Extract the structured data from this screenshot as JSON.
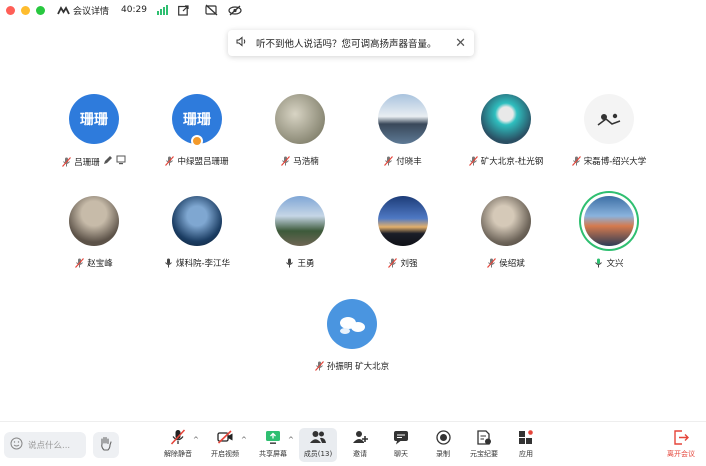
{
  "titlebar": {
    "app_label": "会议详情",
    "timer": "40:29",
    "traffic_colors": [
      "#ff5f57",
      "#febc2e",
      "#28c840"
    ]
  },
  "notice": {
    "text": "听不到他人说话吗？您可调高扬声器音量。"
  },
  "participants": [
    {
      "name": "吕珊珊",
      "avatar_text": "珊珊",
      "status": "muted",
      "extra_icons": true
    },
    {
      "name": "中绿盟吕珊珊",
      "avatar_text": "珊珊",
      "status": "muted",
      "host_badge": true
    },
    {
      "name": "马浩楠",
      "status": "muted",
      "avatar_color": "#6b6a55"
    },
    {
      "name": "付晓丰",
      "status": "muted",
      "avatar_color": "#5e7a96"
    },
    {
      "name": "矿大北京-杜光钢",
      "status": "muted",
      "avatar_color": "#2a4f63"
    },
    {
      "name": "宋磊博-绍兴大学",
      "status": "muted",
      "avatar_color": "#f4f4f4"
    },
    {
      "name": "赵宝峰",
      "status": "muted",
      "avatar_color": "#5c5248"
    },
    {
      "name": "煤科院-李江华",
      "status": "unmuted",
      "avatar_color": "#1b3d63"
    },
    {
      "name": "王勇",
      "status": "unmuted",
      "avatar_color": "#3d5a3a"
    },
    {
      "name": "刘强",
      "status": "muted",
      "avatar_color": "#2e4d84"
    },
    {
      "name": "侯绍斌",
      "status": "muted",
      "avatar_color": "#6e655a"
    },
    {
      "name": "文兴",
      "status": "speaking",
      "avatar_color": "#3d6fa5"
    },
    {
      "name": "孙振明 矿大北京",
      "status": "muted",
      "avatar_color": "#4a95e0"
    }
  ],
  "bottombar": {
    "say_placeholder": "说点什么...",
    "buttons": [
      {
        "label": "解除静音"
      },
      {
        "label": "开启视频"
      },
      {
        "label": "共享屏幕"
      },
      {
        "label": "成员(13)"
      },
      {
        "label": "邀请"
      },
      {
        "label": "聊天"
      },
      {
        "label": "录制"
      },
      {
        "label": "元宝纪要"
      },
      {
        "label": "应用"
      },
      {
        "label": "离开会议"
      }
    ],
    "leave_color": "#e5453a"
  }
}
